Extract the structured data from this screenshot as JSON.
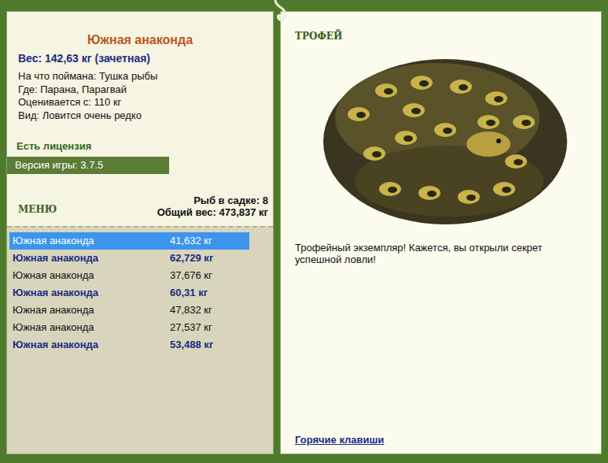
{
  "fish": {
    "name": "Южная анаконда",
    "weight": "Вес: 142,63 кг (зачетная)",
    "details": [
      "На что поймана: Тушка рыбы",
      "Где: Парана, Парагвай",
      "Оценивается с: 110 кг",
      "Вид: Ловится очень редко"
    ],
    "license": "Есть лицензия"
  },
  "version": "Версия игры: 3.7.5",
  "menu": {
    "label": "МЕНЮ"
  },
  "keepnet": {
    "count": "Рыб в садке: 8",
    "total": "Общий вес: 473,837 кг"
  },
  "catches": [
    {
      "name": "Южная анаконда",
      "weight": "41,632 кг",
      "selected": true,
      "scoring": false
    },
    {
      "name": "Южная анаконда",
      "weight": "62,729 кг",
      "selected": false,
      "scoring": true
    },
    {
      "name": "Южная анаконда",
      "weight": "37,676 кг",
      "selected": false,
      "scoring": false
    },
    {
      "name": "Южная анаконда",
      "weight": "60,31 кг",
      "selected": false,
      "scoring": true
    },
    {
      "name": "Южная анаконда",
      "weight": "47,832 кг",
      "selected": false,
      "scoring": false
    },
    {
      "name": "Южная анаконда",
      "weight": "27,537 кг",
      "selected": false,
      "scoring": false
    },
    {
      "name": "Южная анаконда",
      "weight": "53,488 кг",
      "selected": false,
      "scoring": true
    }
  ],
  "trophy": {
    "label": "ТРОФЕЙ",
    "message": "Трофейный экземпляр! Кажется, вы открыли секрет успешной ловли!",
    "hotkeys": "Горячие клавиши"
  }
}
